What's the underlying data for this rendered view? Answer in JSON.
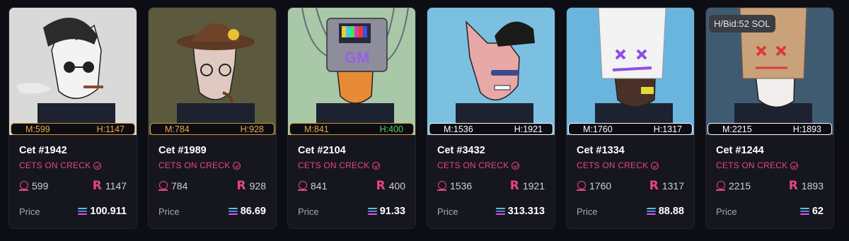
{
  "cards": [
    {
      "title": "Cet #1942",
      "collection": "CETS ON CRECK",
      "rank_m": "599",
      "rank_h": "1147",
      "pill_m": "M:599",
      "pill_h": "H:1147",
      "pill_style": "gold",
      "price_label": "Price",
      "price": "100.911",
      "bg": "#d6d6d6"
    },
    {
      "title": "Cet #1989",
      "collection": "CETS ON CRECK",
      "rank_m": "784",
      "rank_h": "928",
      "pill_m": "M:784",
      "pill_h": "H:928",
      "pill_style": "gold",
      "price_label": "Price",
      "price": "86.69",
      "bg": "#5a583e"
    },
    {
      "title": "Cet #2104",
      "collection": "CETS ON CRECK",
      "rank_m": "841",
      "rank_h": "400",
      "pill_m": "M:841",
      "pill_h": "H:400",
      "pill_style": "gold-green",
      "price_label": "Price",
      "price": "91.33",
      "bg": "#a7c7a6"
    },
    {
      "title": "Cet #3432",
      "collection": "CETS ON CRECK",
      "rank_m": "1536",
      "rank_h": "1921",
      "pill_m": "M:1536",
      "pill_h": "H:1921",
      "pill_style": "white",
      "price_label": "Price",
      "price": "313.313",
      "bg": "#7cbfe0"
    },
    {
      "title": "Cet #1334",
      "collection": "CETS ON CRECK",
      "rank_m": "1760",
      "rank_h": "1317",
      "pill_m": "M:1760",
      "pill_h": "H:1317",
      "pill_style": "white",
      "price_label": "Price",
      "price": "88.88",
      "bg": "#6ab4dd"
    },
    {
      "title": "Cet #1244",
      "collection": "CETS ON CRECK",
      "rank_m": "2215",
      "rank_h": "1893",
      "pill_m": "M:2215",
      "pill_h": "H:1893",
      "pill_style": "white",
      "price_label": "Price",
      "price": "62",
      "bid_tag": "H/Bid:52 SOL",
      "bg": "#3f5b70"
    }
  ],
  "colors": {
    "page_bg": "#0d0d14",
    "card_bg": "#16161f",
    "accent_pink": "#e8467f",
    "gold": "#d6962f",
    "green": "#53d15f"
  },
  "icons": {
    "verified": "verified-check-icon",
    "moonrank": "moonrank-icon",
    "howrare": "howrare-r-icon",
    "solana": "solana-icon"
  }
}
